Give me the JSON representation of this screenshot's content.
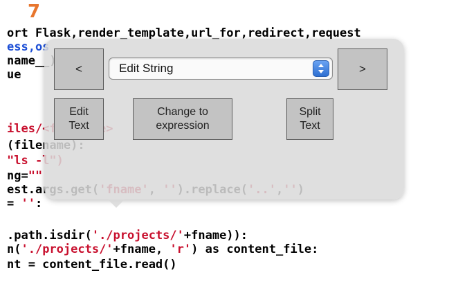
{
  "step_number": "7",
  "code_lines": [
    {
      "segments": [
        {
          "text": "ort Flask,render_template,url_for,redirect,request",
          "kind": "plain"
        }
      ]
    },
    {
      "segments": [
        {
          "text": "ess,os",
          "kind": "kw"
        }
      ]
    },
    {
      "segments": [
        {
          "text": "name__)",
          "kind": "plain"
        }
      ]
    },
    {
      "segments": [
        {
          "text": "ue",
          "kind": "plain"
        }
      ]
    },
    {
      "segments": [
        {
          "text": "",
          "kind": "plain"
        }
      ]
    },
    {
      "segments": [
        {
          "text": "",
          "kind": "plain"
        }
      ]
    },
    {
      "segments": [
        {
          "text": "iles/<filename>",
          "kind": "str"
        }
      ]
    },
    {
      "segments": [
        {
          "text": "(filename):",
          "kind": "plain"
        }
      ]
    },
    {
      "segments": [
        {
          "text": "\"ls -l\")",
          "kind": "str"
        }
      ]
    },
    {
      "segments": [
        {
          "text": "ng=",
          "kind": "plain"
        },
        {
          "text": "\"\"",
          "kind": "str"
        }
      ]
    },
    {
      "segments": [
        {
          "text": "est.args.get(",
          "kind": "plain"
        },
        {
          "text": "'fname'",
          "kind": "str"
        },
        {
          "text": ", ",
          "kind": "plain"
        },
        {
          "text": "''",
          "kind": "str"
        },
        {
          "text": ").replace(",
          "kind": "plain"
        },
        {
          "text": "'..'",
          "kind": "str"
        },
        {
          "text": ",",
          "kind": "plain"
        },
        {
          "text": "''",
          "kind": "str"
        },
        {
          "text": ")",
          "kind": "plain"
        }
      ]
    },
    {
      "segments": [
        {
          "text": "= ",
          "kind": "plain"
        },
        {
          "text": "''",
          "kind": "str"
        },
        {
          "text": ":",
          "kind": "plain"
        }
      ]
    },
    {
      "segments": [
        {
          "text": "",
          "kind": "plain"
        }
      ]
    },
    {
      "segments": [
        {
          "text": ".path.isdir(",
          "kind": "plain"
        },
        {
          "text": "'./projects/'",
          "kind": "str"
        },
        {
          "text": "+fname)):",
          "kind": "plain"
        }
      ]
    },
    {
      "segments": [
        {
          "text": "n(",
          "kind": "plain"
        },
        {
          "text": "'./projects/'",
          "kind": "str"
        },
        {
          "text": "+fname, ",
          "kind": "plain"
        },
        {
          "text": "'r'",
          "kind": "str"
        },
        {
          "text": ") as content_file:",
          "kind": "plain"
        }
      ]
    },
    {
      "segments": [
        {
          "text": "nt = content_file.read()",
          "kind": "plain"
        }
      ]
    }
  ],
  "popup": {
    "prev_label": "<",
    "next_label": ">",
    "select_value": "Edit String",
    "edit_text_label": "Edit\nText",
    "change_expression_label": "Change to\nexpression",
    "split_text_label": "Split\nText"
  },
  "colors": {
    "step_badge": "#e8762d",
    "keyword": "#1d4fd6",
    "string": "#c8102e"
  }
}
